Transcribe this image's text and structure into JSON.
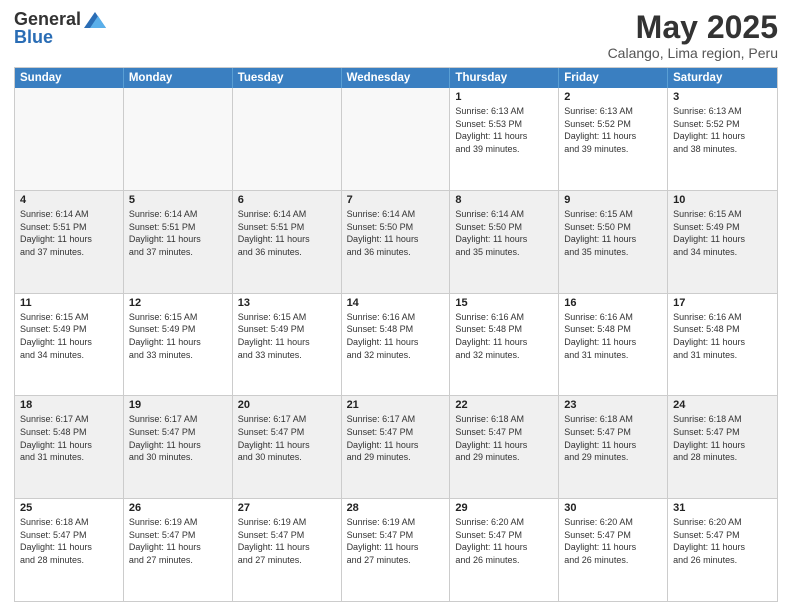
{
  "header": {
    "logo_general": "General",
    "logo_blue": "Blue",
    "month": "May 2025",
    "location": "Calango, Lima region, Peru"
  },
  "days_of_week": [
    "Sunday",
    "Monday",
    "Tuesday",
    "Wednesday",
    "Thursday",
    "Friday",
    "Saturday"
  ],
  "weeks": [
    [
      {
        "day": "",
        "info": "",
        "empty": true
      },
      {
        "day": "",
        "info": "",
        "empty": true
      },
      {
        "day": "",
        "info": "",
        "empty": true
      },
      {
        "day": "",
        "info": "",
        "empty": true
      },
      {
        "day": "1",
        "info": "Sunrise: 6:13 AM\nSunset: 5:53 PM\nDaylight: 11 hours\nand 39 minutes.",
        "empty": false
      },
      {
        "day": "2",
        "info": "Sunrise: 6:13 AM\nSunset: 5:52 PM\nDaylight: 11 hours\nand 39 minutes.",
        "empty": false
      },
      {
        "day": "3",
        "info": "Sunrise: 6:13 AM\nSunset: 5:52 PM\nDaylight: 11 hours\nand 38 minutes.",
        "empty": false
      }
    ],
    [
      {
        "day": "4",
        "info": "Sunrise: 6:14 AM\nSunset: 5:51 PM\nDaylight: 11 hours\nand 37 minutes.",
        "empty": false
      },
      {
        "day": "5",
        "info": "Sunrise: 6:14 AM\nSunset: 5:51 PM\nDaylight: 11 hours\nand 37 minutes.",
        "empty": false
      },
      {
        "day": "6",
        "info": "Sunrise: 6:14 AM\nSunset: 5:51 PM\nDaylight: 11 hours\nand 36 minutes.",
        "empty": false
      },
      {
        "day": "7",
        "info": "Sunrise: 6:14 AM\nSunset: 5:50 PM\nDaylight: 11 hours\nand 36 minutes.",
        "empty": false
      },
      {
        "day": "8",
        "info": "Sunrise: 6:14 AM\nSunset: 5:50 PM\nDaylight: 11 hours\nand 35 minutes.",
        "empty": false
      },
      {
        "day": "9",
        "info": "Sunrise: 6:15 AM\nSunset: 5:50 PM\nDaylight: 11 hours\nand 35 minutes.",
        "empty": false
      },
      {
        "day": "10",
        "info": "Sunrise: 6:15 AM\nSunset: 5:49 PM\nDaylight: 11 hours\nand 34 minutes.",
        "empty": false
      }
    ],
    [
      {
        "day": "11",
        "info": "Sunrise: 6:15 AM\nSunset: 5:49 PM\nDaylight: 11 hours\nand 34 minutes.",
        "empty": false
      },
      {
        "day": "12",
        "info": "Sunrise: 6:15 AM\nSunset: 5:49 PM\nDaylight: 11 hours\nand 33 minutes.",
        "empty": false
      },
      {
        "day": "13",
        "info": "Sunrise: 6:15 AM\nSunset: 5:49 PM\nDaylight: 11 hours\nand 33 minutes.",
        "empty": false
      },
      {
        "day": "14",
        "info": "Sunrise: 6:16 AM\nSunset: 5:48 PM\nDaylight: 11 hours\nand 32 minutes.",
        "empty": false
      },
      {
        "day": "15",
        "info": "Sunrise: 6:16 AM\nSunset: 5:48 PM\nDaylight: 11 hours\nand 32 minutes.",
        "empty": false
      },
      {
        "day": "16",
        "info": "Sunrise: 6:16 AM\nSunset: 5:48 PM\nDaylight: 11 hours\nand 31 minutes.",
        "empty": false
      },
      {
        "day": "17",
        "info": "Sunrise: 6:16 AM\nSunset: 5:48 PM\nDaylight: 11 hours\nand 31 minutes.",
        "empty": false
      }
    ],
    [
      {
        "day": "18",
        "info": "Sunrise: 6:17 AM\nSunset: 5:48 PM\nDaylight: 11 hours\nand 31 minutes.",
        "empty": false
      },
      {
        "day": "19",
        "info": "Sunrise: 6:17 AM\nSunset: 5:47 PM\nDaylight: 11 hours\nand 30 minutes.",
        "empty": false
      },
      {
        "day": "20",
        "info": "Sunrise: 6:17 AM\nSunset: 5:47 PM\nDaylight: 11 hours\nand 30 minutes.",
        "empty": false
      },
      {
        "day": "21",
        "info": "Sunrise: 6:17 AM\nSunset: 5:47 PM\nDaylight: 11 hours\nand 29 minutes.",
        "empty": false
      },
      {
        "day": "22",
        "info": "Sunrise: 6:18 AM\nSunset: 5:47 PM\nDaylight: 11 hours\nand 29 minutes.",
        "empty": false
      },
      {
        "day": "23",
        "info": "Sunrise: 6:18 AM\nSunset: 5:47 PM\nDaylight: 11 hours\nand 29 minutes.",
        "empty": false
      },
      {
        "day": "24",
        "info": "Sunrise: 6:18 AM\nSunset: 5:47 PM\nDaylight: 11 hours\nand 28 minutes.",
        "empty": false
      }
    ],
    [
      {
        "day": "25",
        "info": "Sunrise: 6:18 AM\nSunset: 5:47 PM\nDaylight: 11 hours\nand 28 minutes.",
        "empty": false
      },
      {
        "day": "26",
        "info": "Sunrise: 6:19 AM\nSunset: 5:47 PM\nDaylight: 11 hours\nand 27 minutes.",
        "empty": false
      },
      {
        "day": "27",
        "info": "Sunrise: 6:19 AM\nSunset: 5:47 PM\nDaylight: 11 hours\nand 27 minutes.",
        "empty": false
      },
      {
        "day": "28",
        "info": "Sunrise: 6:19 AM\nSunset: 5:47 PM\nDaylight: 11 hours\nand 27 minutes.",
        "empty": false
      },
      {
        "day": "29",
        "info": "Sunrise: 6:20 AM\nSunset: 5:47 PM\nDaylight: 11 hours\nand 26 minutes.",
        "empty": false
      },
      {
        "day": "30",
        "info": "Sunrise: 6:20 AM\nSunset: 5:47 PM\nDaylight: 11 hours\nand 26 minutes.",
        "empty": false
      },
      {
        "day": "31",
        "info": "Sunrise: 6:20 AM\nSunset: 5:47 PM\nDaylight: 11 hours\nand 26 minutes.",
        "empty": false
      }
    ]
  ]
}
